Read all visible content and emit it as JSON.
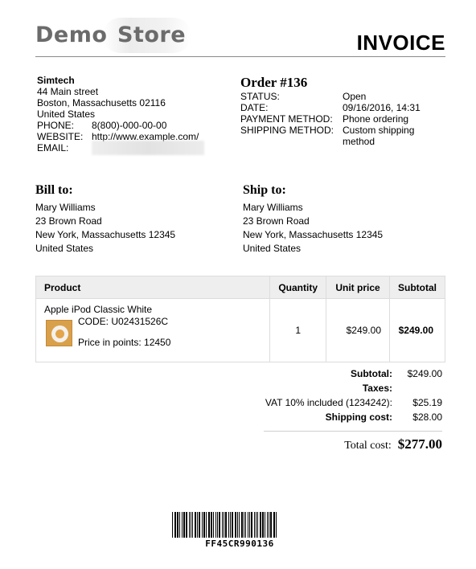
{
  "brand": {
    "word1": "Demo",
    "word2": "Store"
  },
  "title": "INVOICE",
  "company": {
    "name": "Simtech",
    "street": "44 Main street",
    "city_line": "Boston, Massachusetts 02116",
    "country": "United States",
    "phone_label": "PHONE:",
    "phone": "8(800)-000-00-00",
    "website_label": "WEBSITE:",
    "website": "http://www.example.com/",
    "email_label": "EMAIL:"
  },
  "order": {
    "title": "Order #136",
    "rows": [
      {
        "label": "STATUS:",
        "value": "Open"
      },
      {
        "label": "DATE:",
        "value": "09/16/2016, 14:31"
      },
      {
        "label": "PAYMENT METHOD:",
        "value": "Phone ordering"
      },
      {
        "label": "SHIPPING METHOD:",
        "value": "Custom shipping method"
      }
    ]
  },
  "bill_to": {
    "heading": "Bill to:",
    "name": "Mary Williams",
    "street": "23 Brown Road",
    "city_line": "New York, Massachusetts 12345",
    "country": "United States"
  },
  "ship_to": {
    "heading": "Ship to:",
    "name": "Mary Williams",
    "street": "23 Brown Road",
    "city_line": "New York, Massachusetts 12345",
    "country": "United States"
  },
  "table": {
    "headers": {
      "product": "Product",
      "quantity": "Quantity",
      "unit_price": "Unit price",
      "subtotal": "Subtotal"
    },
    "items": [
      {
        "name": "Apple iPod Classic White",
        "code": "CODE: U02431526C",
        "points": "Price in points: 12450",
        "quantity": "1",
        "unit_price": "$249.00",
        "subtotal": "$249.00"
      }
    ]
  },
  "totals": {
    "subtotal_label": "Subtotal:",
    "subtotal": "$249.00",
    "taxes_label": "Taxes:",
    "vat_label": "VAT 10% included (1234242):",
    "vat": "$25.19",
    "shipping_label": "Shipping cost:",
    "shipping": "$28.00",
    "total_label": "Total cost:",
    "total": "$277.00"
  },
  "barcode": {
    "text": "FF45CR990136"
  }
}
